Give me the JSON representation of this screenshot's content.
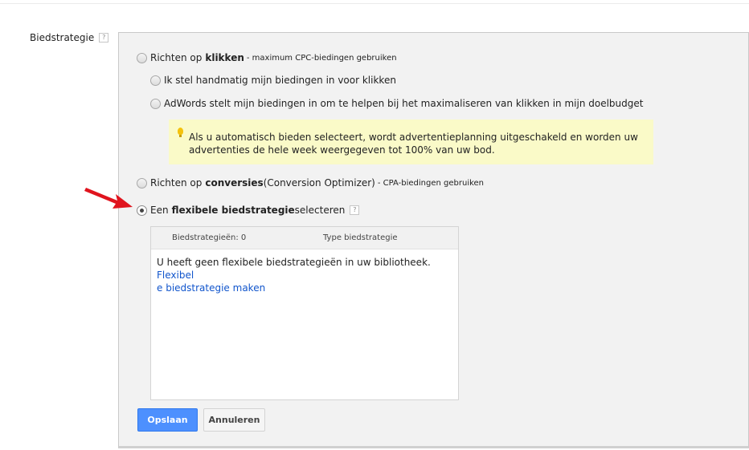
{
  "label": {
    "text": "Biedstrategie",
    "help": "?"
  },
  "option_clicks": {
    "prefix": "Richten op ",
    "bold": "klikken",
    "suffix": " - maximum CPC-biedingen gebruiken"
  },
  "sub_manual": "Ik stel handmatig mijn biedingen in voor klikken",
  "sub_auto": "AdWords stelt mijn biedingen in om te helpen bij het maximaliseren van klikken in mijn doelbudget",
  "hint": {
    "line1": "Als u automatisch bieden selecteert, wordt advertentieplanning uitgeschakeld en worden uw",
    "line2": "advertenties de hele week weergegeven tot 100% van uw bod."
  },
  "option_conversions": {
    "prefix": "Richten op ",
    "bold": "conversies",
    "middle": " (Conversion Optimizer)",
    "suffix": " - CPA-biedingen gebruiken"
  },
  "option_flexible": {
    "prefix": "Een ",
    "bold": "flexibele biedstrategie",
    "suffix": " selecteren",
    "help": "?"
  },
  "table": {
    "col1": "Biedstrategieën: 0",
    "col2": "Type biedstrategie",
    "message": "U heeft geen flexibele biedstrategieën in uw bibliotheek. ",
    "link_line1": "Flexibel",
    "link_line2": "e biedstrategie maken"
  },
  "buttons": {
    "save": "Opslaan",
    "cancel": "Annuleren"
  },
  "colors": {
    "primary": "#4d90fe",
    "link": "#1155cc",
    "hint_bg": "#fafac8",
    "arrow": "#e0141e"
  },
  "icons": {
    "hint": "lightbulb-icon",
    "pointer": "red-arrow-icon"
  }
}
